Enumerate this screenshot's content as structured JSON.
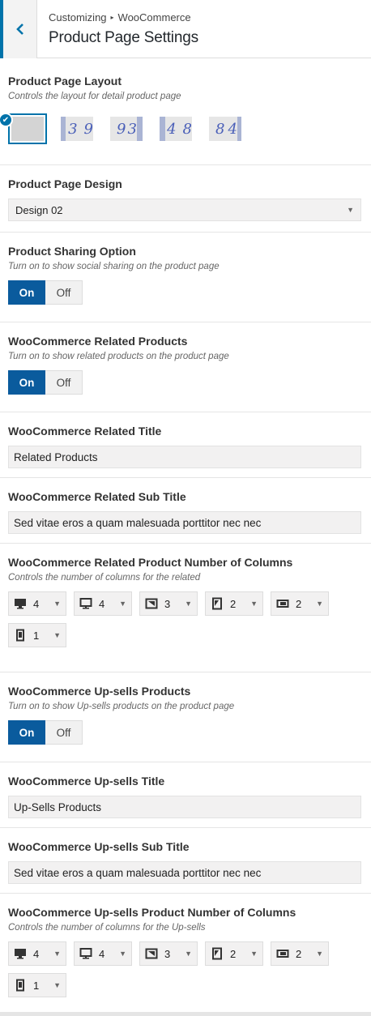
{
  "header": {
    "breadcrumb_parent": "Customizing",
    "breadcrumb_separator": "▸",
    "breadcrumb_child": "WooCommerce",
    "title": "Product Page Settings",
    "back_icon": "chevron-left-icon"
  },
  "layout": {
    "title": "Product Page Layout",
    "description": "Controls the layout for detail product page",
    "options": [
      {
        "left": "",
        "right": "",
        "selected": true
      },
      {
        "left": "3",
        "right": "9",
        "selected": false
      },
      {
        "left": "9",
        "right": "3",
        "selected": false
      },
      {
        "left": "4",
        "right": "8",
        "selected": false
      },
      {
        "left": "8",
        "right": "4",
        "selected": false
      }
    ]
  },
  "design": {
    "title": "Product Page Design",
    "value": "Design 02"
  },
  "sharing": {
    "title": "Product Sharing Option",
    "description": "Turn on to show social sharing on the product page",
    "on_label": "On",
    "off_label": "Off"
  },
  "related": {
    "title": "WooCommerce Related Products",
    "description": "Turn on to show related products on the product page",
    "on_label": "On",
    "off_label": "Off"
  },
  "related_title": {
    "title": "WooCommerce Related Title",
    "value": "Related Products"
  },
  "related_subtitle": {
    "title": "WooCommerce Related Sub Title",
    "value": "Sed vitae eros a quam malesuada porttitor nec nec"
  },
  "related_columns": {
    "title": "WooCommerce Related Product Number of Columns",
    "description": "Controls the number of columns for the related",
    "values": [
      "4",
      "4",
      "3",
      "2",
      "2",
      "1"
    ]
  },
  "upsells": {
    "title": "WooCommerce Up-sells Products",
    "description": "Turn on to show Up-sells products on the product page",
    "on_label": "On",
    "off_label": "Off"
  },
  "upsells_title": {
    "title": "WooCommerce Up-sells Title",
    "value": "Up-Sells Products"
  },
  "upsells_subtitle": {
    "title": "WooCommerce Up-sells Sub Title",
    "value": "Sed vitae eros a quam malesuada porttitor nec nec"
  },
  "upsells_columns": {
    "title": "WooCommerce Up-sells Product Number of Columns",
    "description": "Controls the number of columns for the Up-sells",
    "values": [
      "4",
      "4",
      "3",
      "2",
      "2",
      "1"
    ]
  },
  "device_icons": [
    "desktop-large-icon",
    "desktop-icon",
    "tablet-landscape-icon",
    "tablet-portrait-icon",
    "mobile-landscape-icon",
    "mobile-portrait-icon"
  ],
  "colors": {
    "accent": "#0073aa",
    "toggle_on": "#0a5b9d"
  }
}
